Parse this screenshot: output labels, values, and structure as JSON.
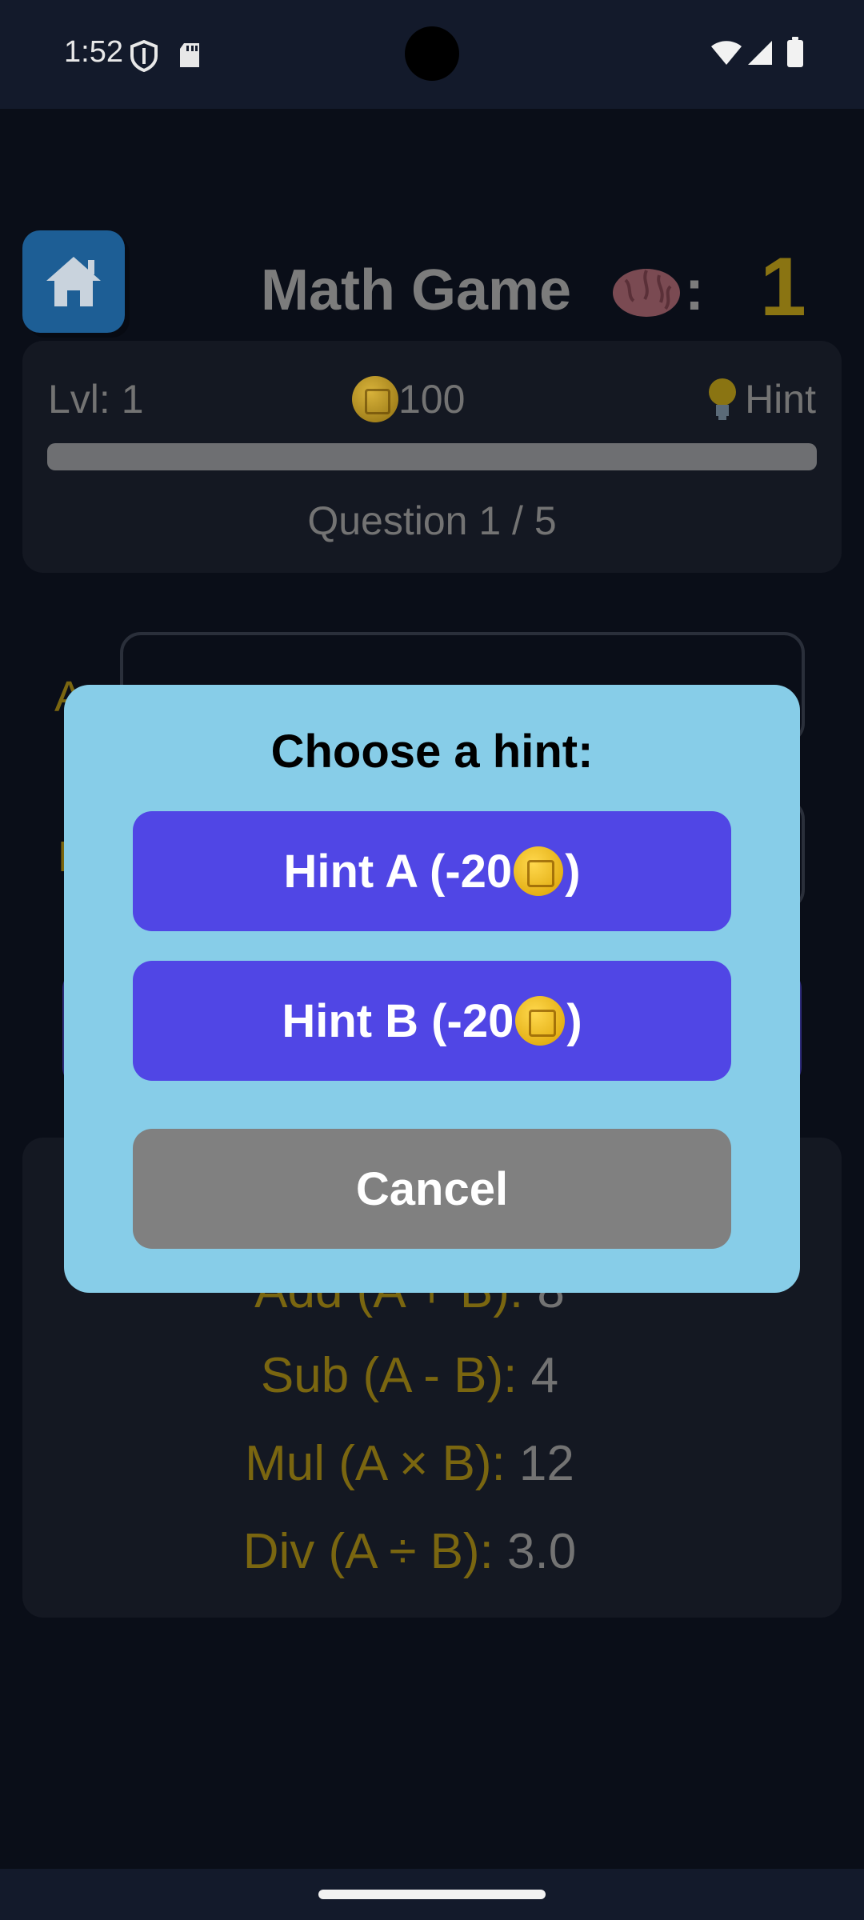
{
  "status_bar": {
    "time": "1:52",
    "icons": [
      "shield-icon",
      "sd-card-icon",
      "wifi-icon",
      "signal-icon",
      "battery-icon"
    ]
  },
  "header": {
    "home_icon": "home-icon",
    "title": "Math Game",
    "brain_emoji": "brain-icon",
    "colon": ":",
    "score": "1"
  },
  "stats": {
    "level": "Lvl: 1",
    "coins": "100",
    "coin_icon": "coin-icon",
    "hint_icon": "lightbulb-icon",
    "hint_label": "Hint",
    "progress": 0,
    "question_counter": "Question 1 / 5"
  },
  "inputs": {
    "a_label": "A",
    "b_label": "B"
  },
  "results": {
    "add_label": "Add (A + B):",
    "add_value": "8",
    "sub_label": "Sub (A - B):",
    "sub_value": "4",
    "mul_label": "Mul (A × B):",
    "mul_value": "12",
    "div_label": "Div (A ÷ B):",
    "div_value": "3.0"
  },
  "dialog": {
    "title": "Choose a hint:",
    "hint_a_label": "Hint A (-20",
    "hint_b_label": "Hint B (-20",
    "close_paren": ")",
    "cancel_label": "Cancel"
  },
  "colors": {
    "background": "#0a0e18",
    "dialog_bg": "#87cde8",
    "hint_button": "#5046e5",
    "cancel_button": "#808080",
    "accent_gold": "#8a7412"
  }
}
